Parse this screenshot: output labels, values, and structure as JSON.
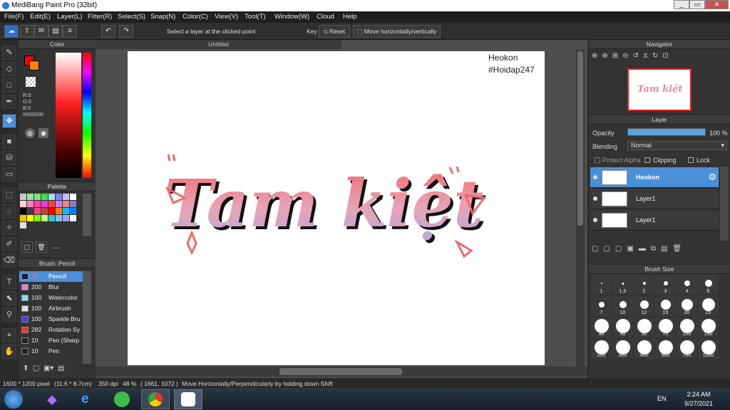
{
  "window": {
    "title": "MediBang Paint Pro (32bit)"
  },
  "menu": [
    "File(F)",
    "Edit(E)",
    "Layer(L)",
    "Filter(R)",
    "Select(S)",
    "Snap(N)",
    "Color(C)",
    "View(V)",
    "Tool(T)",
    "Window(W)",
    "Cloud",
    "Help"
  ],
  "toolbar": {
    "select_layer_label": "Select a layer at the clicked point",
    "key_label": "Key",
    "reset_label": "Reset",
    "move_label": "Move horizontally/vertically"
  },
  "color_panel": {
    "title": "Color",
    "r": "R:0",
    "g": "G:0",
    "b": "B:0",
    "hex": "#000000"
  },
  "palette_panel": {
    "title": "Palette",
    "more": "---",
    "colors": [
      "#c8c8c8",
      "#a0e0a0",
      "#80e080",
      "#40e040",
      "#a0e0e0",
      "#8080ff",
      "#c0c0ff",
      "#ffffff",
      "#ffd0d0",
      "#ff80c0",
      "#ff40a0",
      "#e040e0",
      "#ff4040",
      "#c080ff",
      "#ff8080",
      "#8080c0",
      "#000000",
      "#404040",
      "#ff4080",
      "#c04040",
      "#ff0000",
      "#ff8000",
      "#00c0ff",
      "#0080ff",
      "#ffc000",
      "#ffff00",
      "#80ff00",
      "#c0ff80",
      "#40c0c0",
      "#80c0ff",
      "#a0a0ff",
      "#ffffff",
      "#e0e0e0"
    ]
  },
  "brush_panel": {
    "title": "Brush: Pencil",
    "brushes": [
      {
        "size": "10",
        "name": "Pencil",
        "color": "#1a1a3a",
        "selected": true
      },
      {
        "size": "200",
        "name": "Blur",
        "color": "#e080e0"
      },
      {
        "size": "100",
        "name": "Watercolor",
        "color": "#80e0ff"
      },
      {
        "size": "100",
        "name": "Airbrush",
        "color": "#e0e0e0"
      },
      {
        "size": "100",
        "name": "Sparkle Bru",
        "color": "#4040ff"
      },
      {
        "size": "282",
        "name": "Rotation Sy",
        "color": "#ff3030"
      },
      {
        "size": "10",
        "name": "Pen (Sharp",
        "color": "#222222"
      },
      {
        "size": "10",
        "name": "Pen",
        "color": "#222222"
      }
    ]
  },
  "document": {
    "tab": "Untitled",
    "watermark_line1": "Heokon",
    "watermark_line2": "#Hoidap247"
  },
  "artwork": {
    "text": "Tam kiệt"
  },
  "navigator": {
    "title": "Navigator"
  },
  "layer_panel": {
    "title": "Layer",
    "opacity_label": "Opacity",
    "opacity_value": "100 %",
    "opacity": 1.0,
    "blending_label": "Blending",
    "blending_value": "Normal",
    "protect_alpha": "Protect Alpha",
    "clipping": "Clipping",
    "lock": "Lock",
    "layers": [
      {
        "name": "Heokon",
        "selected": true
      },
      {
        "name": "Layer1"
      },
      {
        "name": "Layer1"
      }
    ]
  },
  "brush_size_panel": {
    "title": "Brush Size",
    "sizes": [
      "1",
      "1.5",
      "2",
      "3",
      "4",
      "5",
      "7",
      "10",
      "12",
      "15",
      "20",
      "25",
      "30",
      "40",
      "50",
      "70",
      "100",
      "150",
      "200",
      "300",
      "400",
      "500",
      "700",
      "1000"
    ]
  },
  "status": {
    "size": "1600 * 1200 pixel",
    "cm": "(11.6 * 8.7cm)",
    "dpi": "350 dpi",
    "zoom": "48 %",
    "coords": "( 1661, 1072 )",
    "hint": "Move Horizontally/Perpendicularly by holding down Shift"
  },
  "taskbar": {
    "lang": "EN",
    "time": "2:24 AM",
    "date": "9/27/2021"
  },
  "colors": {
    "accent": "#4a90d9",
    "fg": "#ff0000",
    "bg": "#ff8000"
  }
}
